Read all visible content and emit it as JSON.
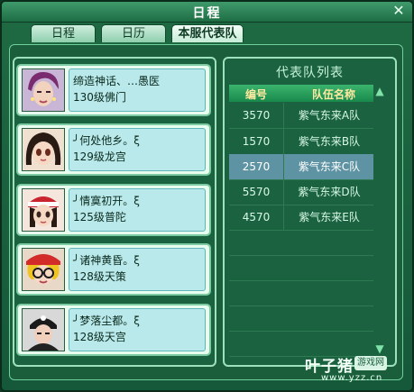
{
  "window": {
    "title": "日程"
  },
  "tabs": [
    {
      "label": "日程"
    },
    {
      "label": "日历"
    },
    {
      "label": "本服代表队"
    }
  ],
  "members": [
    {
      "name": "缔造神话、…愚医",
      "level": "130级佛门"
    },
    {
      "name": "╯何处他乡。ξ",
      "level": "129级龙宫"
    },
    {
      "name": "╯情寞初开。ξ",
      "level": "125级普陀"
    },
    {
      "name": "╯诸神黄昏。ξ",
      "level": "128级天策"
    },
    {
      "name": "╯梦落尘都。ξ",
      "level": "128级天宫"
    }
  ],
  "team_list": {
    "title": "代表队列表",
    "columns": [
      "编号",
      "队伍名称"
    ],
    "rows": [
      {
        "id": "3570",
        "name": "紫气东来A队"
      },
      {
        "id": "1570",
        "name": "紫气东来B队"
      },
      {
        "id": "2570",
        "name": "紫气东来C队"
      },
      {
        "id": "5570",
        "name": "紫气东来D队"
      },
      {
        "id": "4570",
        "name": "紫气东来E队"
      }
    ],
    "selected_index": 2
  },
  "watermark": {
    "brand": "叶子猪",
    "badge": "游戏网",
    "url": "www.yzz.cn"
  }
}
